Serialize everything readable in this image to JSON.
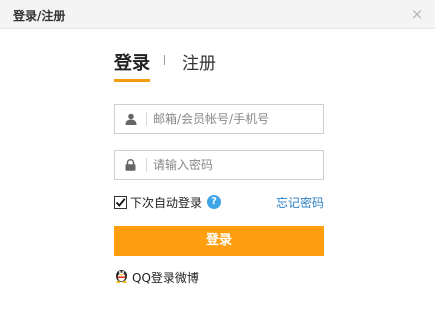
{
  "window": {
    "title": "登录/注册",
    "close_glyph": "×"
  },
  "tabs": {
    "login": "登录",
    "register": "注册"
  },
  "username": {
    "placeholder": "邮箱/会员帐号/手机号",
    "value": "",
    "icon": "user-icon"
  },
  "password": {
    "placeholder": "请输入密码",
    "value": "",
    "icon": "lock-icon"
  },
  "remember": {
    "label": "下次自动登录",
    "checked": true,
    "help_glyph": "?"
  },
  "forgot_label": "忘记密码",
  "login_button_label": "登录",
  "qq_login_label": "QQ登录微博",
  "colors": {
    "accent": "#ff9f0f",
    "link": "#2c80c5",
    "help": "#3fa5e6"
  }
}
